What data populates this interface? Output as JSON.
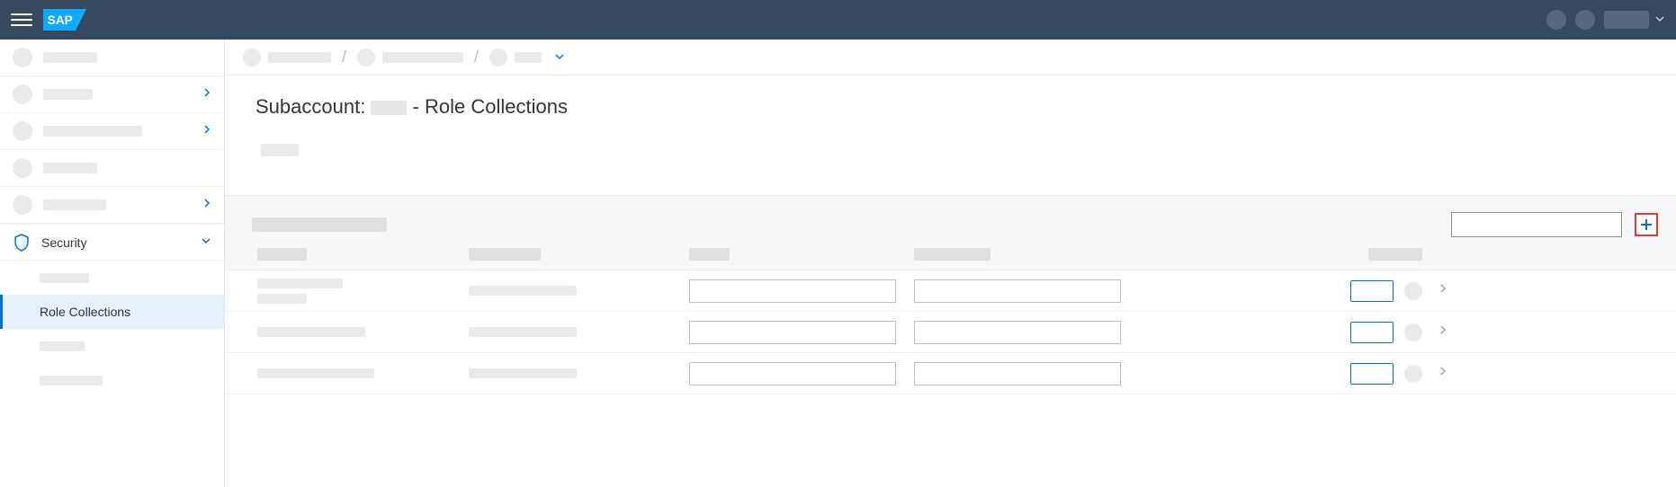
{
  "header": {
    "logo_text": "SAP"
  },
  "sidebar": {
    "security": {
      "label": "Security"
    },
    "role_collections": {
      "label": "Role Collections"
    }
  },
  "page": {
    "title_prefix": "Subaccount: ",
    "title_suffix": " - Role Collections"
  },
  "toolbar": {
    "search_placeholder": ""
  }
}
